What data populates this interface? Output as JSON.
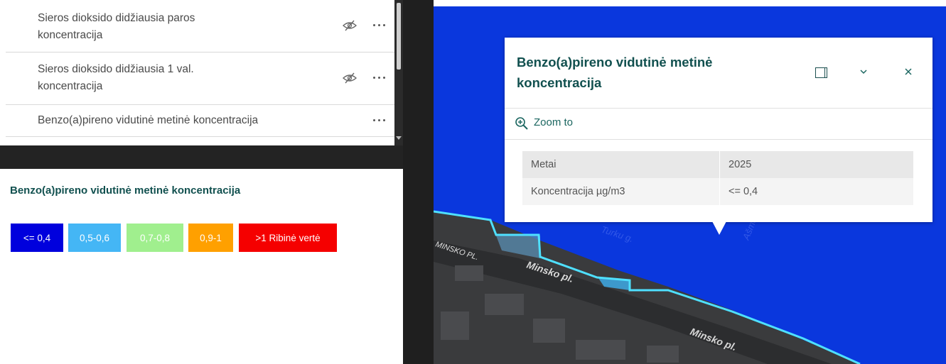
{
  "layers": [
    {
      "label_line1": "Sieros dioksido didžiausia paros",
      "label_line2": "koncentracija",
      "visibility": "hidden"
    },
    {
      "label_line1": "Sieros dioksido didžiausia 1 val.",
      "label_line2": "koncentracija",
      "visibility": "hidden"
    },
    {
      "label_line1": "Benzo(a)pireno vidutinė metinė koncentracija",
      "label_line2": "",
      "visibility": "visible"
    }
  ],
  "legend": {
    "title": "Benzo(a)pireno vidutinė metinė koncentracija",
    "items": [
      {
        "label": "<= 0,4",
        "color": "#0000dd"
      },
      {
        "label": "0,5-0,6",
        "color": "#44b6f5"
      },
      {
        "label": "0,7-0,8",
        "color": "#a0ef8e"
      },
      {
        "label": "0,9-1",
        "color": "#ffa000"
      },
      {
        "label": ">1 Ribinė vertė",
        "color": "#f50000"
      }
    ]
  },
  "map": {
    "fill_color": "#0a37dd",
    "boundary_color": "#4fe0ff",
    "street_labels": [
      "Minsko pl.",
      "Minsko pl.",
      "MINSKO PL.",
      "Turku g.",
      "Ašmenos g."
    ]
  },
  "popup": {
    "title_line1": "Benzo(a)pireno vidutinė metinė",
    "title_line2": "koncentracija",
    "zoom_label": "Zoom to",
    "attributes": [
      {
        "field": "Metai",
        "value": "2025"
      },
      {
        "field": "Koncentracija µg/m3",
        "value": "<= 0,4"
      }
    ]
  }
}
